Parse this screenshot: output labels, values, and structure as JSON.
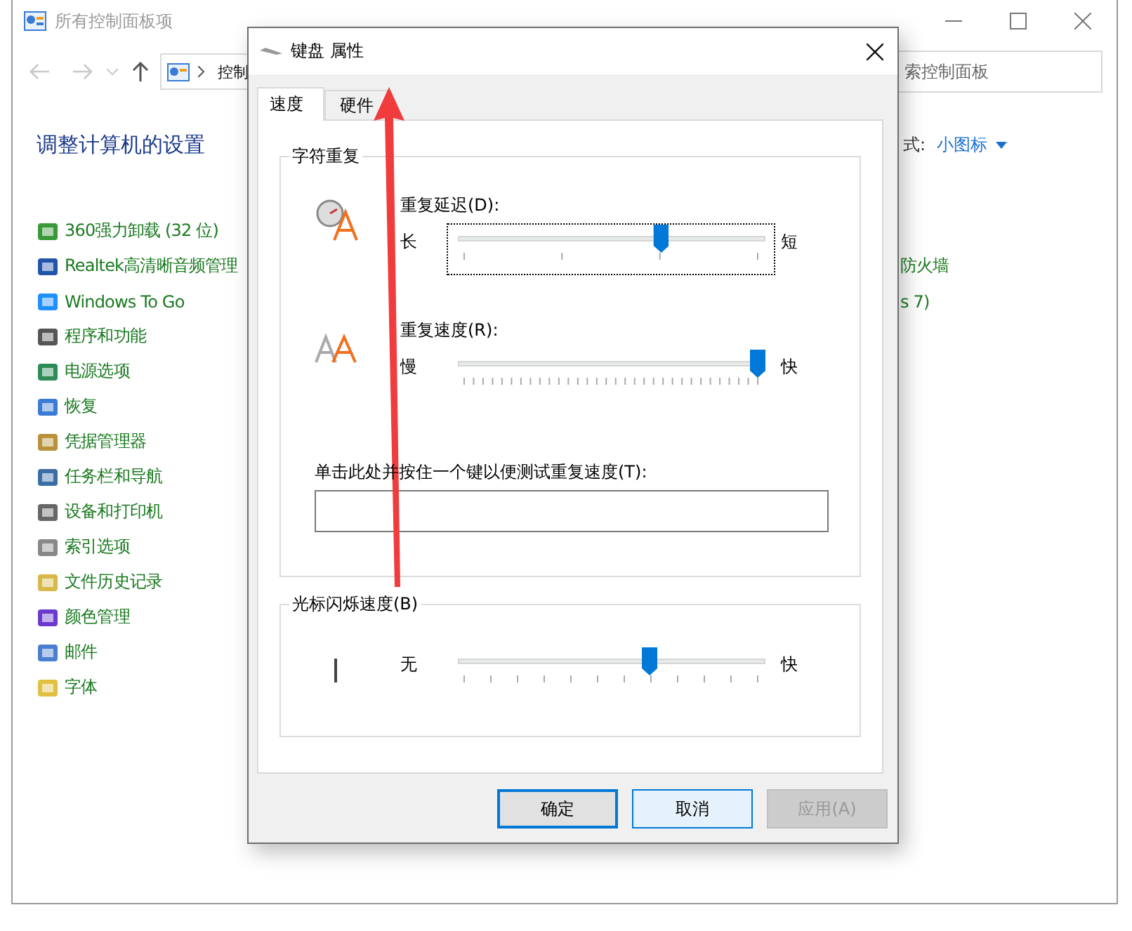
{
  "window": {
    "title": "所有控制面板项"
  },
  "address": {
    "crumb": "控制"
  },
  "search": {
    "placeholder": "索控制面板"
  },
  "heading": "调整计算机的设置",
  "view": {
    "label": "式:",
    "value": "小图标"
  },
  "items": [
    {
      "label": "360强力卸载 (32 位)"
    },
    {
      "label": "Realtek高清晰音频管理"
    },
    {
      "label": "Windows To Go"
    },
    {
      "label": "程序和功能"
    },
    {
      "label": "电源选项"
    },
    {
      "label": "恢复"
    },
    {
      "label": "凭据管理器"
    },
    {
      "label": "任务栏和导航"
    },
    {
      "label": "设备和打印机"
    },
    {
      "label": "索引选项"
    },
    {
      "label": "文件历史记录"
    },
    {
      "label": "颜色管理"
    },
    {
      "label": "邮件"
    },
    {
      "label": "字体"
    }
  ],
  "right_items": [
    {
      "label": "防火墙"
    },
    {
      "label": "s 7)"
    }
  ],
  "dialog": {
    "title": "键盘 属性",
    "tabs": [
      {
        "label": "速度",
        "selected": true
      },
      {
        "label": "硬件",
        "selected": false
      }
    ],
    "repeat": {
      "title": "字符重复",
      "delay": {
        "label": "重复延迟(D):",
        "min": "长",
        "max": "短",
        "level": 0.67,
        "focused": true
      },
      "rate": {
        "label": "重复速度(R):",
        "min": "慢",
        "max": "快",
        "level": 1,
        "focused": false
      },
      "test": {
        "label": "单击此处并按住一个键以便测试重复速度(T):"
      }
    },
    "blink": {
      "title": "光标闪烁速度(B)",
      "min": "无",
      "max": "快",
      "level": 0.63,
      "focused": false
    },
    "buttons": [
      {
        "label": "确定",
        "kind": "default"
      },
      {
        "label": "取消",
        "kind": "hover"
      },
      {
        "label": "应用(A)",
        "kind": "disabled"
      }
    ]
  }
}
